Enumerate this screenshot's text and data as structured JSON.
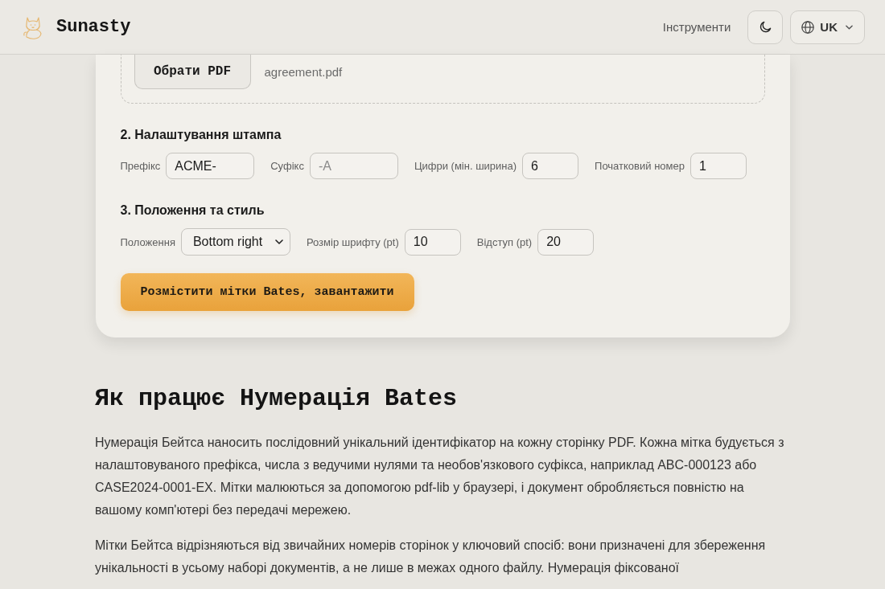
{
  "header": {
    "logo": "Sunasty",
    "nav": [
      {
        "label": "Інструменти"
      }
    ],
    "language": "UK"
  },
  "card": {
    "file": {
      "button": "Обрати PDF",
      "filename": "agreement.pdf"
    },
    "sections": [
      {
        "title": "2. Налаштування штампа",
        "fields": [
          {
            "kind": "text",
            "label": "Префікс",
            "value": "ACME-"
          },
          {
            "kind": "text",
            "label": "Суфікс",
            "placeholder": "-A"
          },
          {
            "kind": "number",
            "label": "Цифри (мін. ширина)",
            "value": "6"
          },
          {
            "kind": "number",
            "label": "Початковий номер",
            "value": "1"
          }
        ]
      },
      {
        "title": "3. Положення та стиль",
        "fields": [
          {
            "kind": "select",
            "label": "Положення",
            "value": "Bottom right"
          },
          {
            "kind": "number",
            "label": "Розмір шрифту (pt)",
            "value": "10"
          },
          {
            "kind": "number",
            "label": "Відступ (pt)",
            "value": "20"
          }
        ]
      }
    ],
    "submit": "Розмістити мітки Bates, завантажити"
  },
  "article": {
    "title": "Як працює Нумерація Bates",
    "paragraphs": [
      "Нумерація Бейтса наносить послідовний унікальний ідентифікатор на кожну сторінку PDF. Кожна мітка будується з налаштовуваного префікса, числа з ведучими нулями та необов'язкового суфікса, наприклад ABC-000123 або CASE2024-0001-EX. Мітки малюються за допомогою pdf-lib у браузері, і документ обробляється повністю на вашому комп'ютері без передачі мережею.",
      "Мітки Бейтса відрізняються від звичайних номерів сторінок у ключовий спосіб: вони призначені для збереження унікальності в усьому наборі документів, а не лише в межах одного файлу. Нумерація фіксованої"
    ]
  }
}
